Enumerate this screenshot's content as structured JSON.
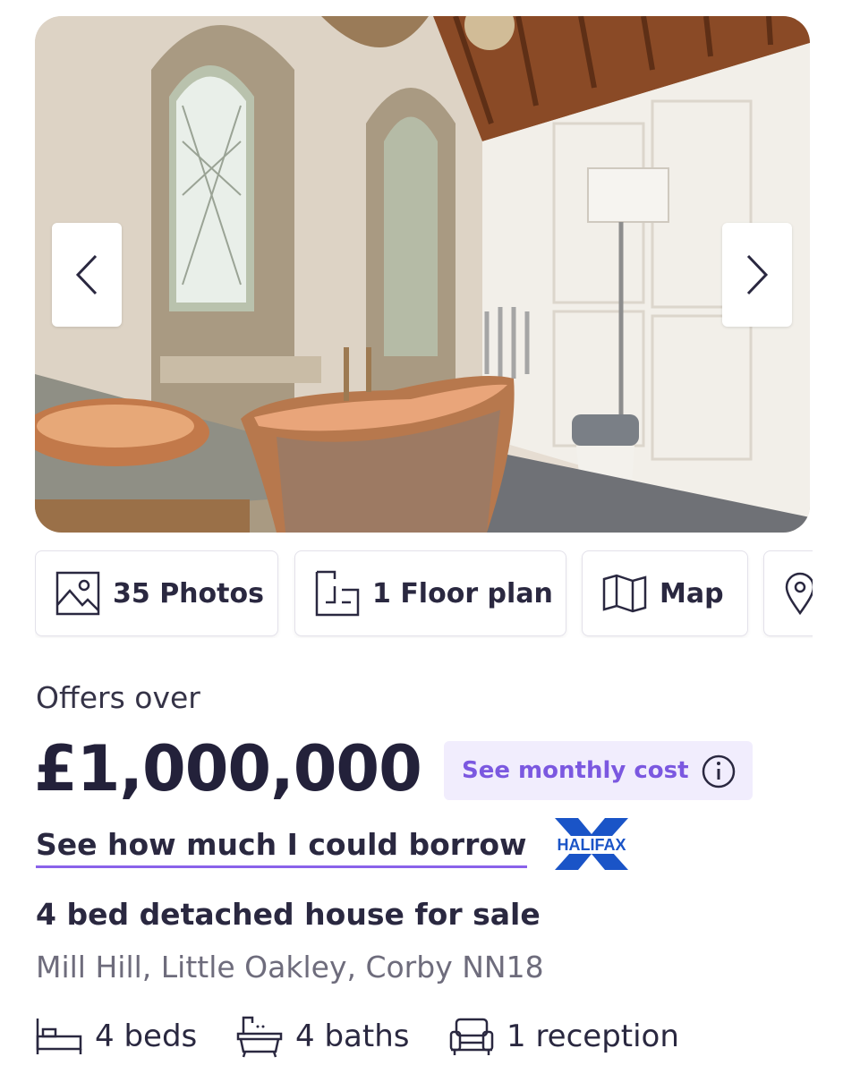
{
  "gallery": {
    "prev_icon": "chevron-left-icon",
    "next_icon": "chevron-right-icon"
  },
  "media_tabs": {
    "photos_label": "35 Photos",
    "floorplan_label": "1 Floor plan",
    "map_label": "Map",
    "photos_icon": "image-icon",
    "floorplan_icon": "floor-plan-icon",
    "map_icon": "map-icon",
    "extra_icon": "location-pin-icon"
  },
  "listing": {
    "price_prefix": "Offers over",
    "price": "£1,000,000",
    "monthly_cost_label": "See monthly cost",
    "monthly_cost_icon": "info-icon",
    "borrow_link": "See how much I could borrow",
    "lender_logo": "HALIFAX",
    "title": "4 bed detached house for sale",
    "address": "Mill Hill, Little Oakley, Corby NN18",
    "features": {
      "beds": "4 beds",
      "baths": "4 baths",
      "receptions": "1 reception",
      "beds_icon": "bed-icon",
      "baths_icon": "bath-icon",
      "receptions_icon": "sofa-icon"
    }
  },
  "colors": {
    "accent": "#8a62ea",
    "accent_text": "#7b58e0",
    "accent_bg": "#f1edfd",
    "text_primary": "#2a2840",
    "text_secondary": "#6e6c7c",
    "halifax_blue": "#1a54c7"
  }
}
